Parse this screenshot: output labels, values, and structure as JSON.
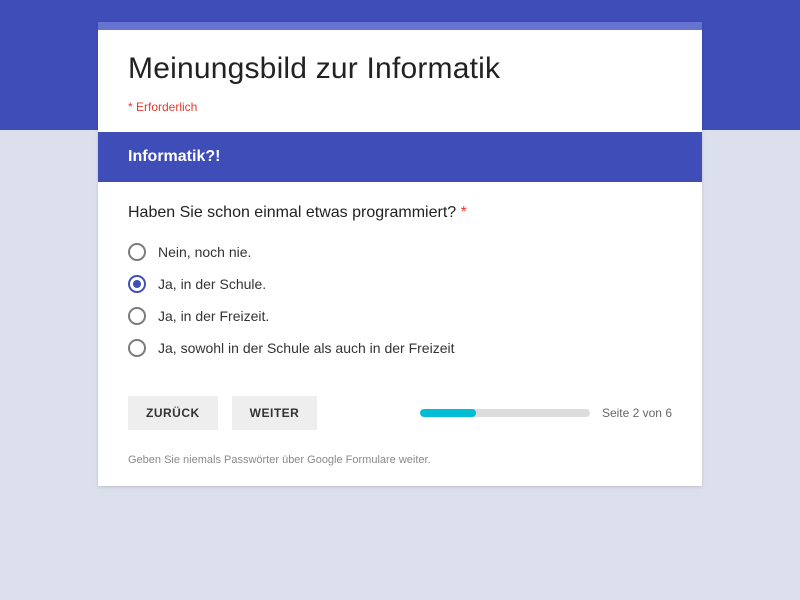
{
  "form": {
    "title": "Meinungsbild zur Informatik",
    "required_note": "* Erforderlich",
    "section_title": "Informatik?!",
    "question": {
      "text": "Haben Sie schon einmal etwas programmiert? ",
      "required_marker": "*",
      "options": [
        {
          "label": "Nein, noch nie.",
          "selected": false
        },
        {
          "label": "Ja, in der Schule.",
          "selected": true
        },
        {
          "label": "Ja, in der Freizeit.",
          "selected": false
        },
        {
          "label": "Ja, sowohl in der Schule als auch in der Freizeit",
          "selected": false
        }
      ]
    },
    "nav": {
      "back_label": "ZURÜCK",
      "next_label": "WEITER"
    },
    "progress": {
      "current": 2,
      "total": 6,
      "page_of_text": "Seite 2 von 6",
      "percent": 33
    },
    "footer_note": "Geben Sie niemals Passwörter über Google Formulare weiter."
  },
  "colors": {
    "accent": "#3f4db8",
    "accent_light": "#6673d0",
    "danger": "#e23b2e",
    "progress": "#00bcd4",
    "page_bg": "#dcdfec"
  }
}
